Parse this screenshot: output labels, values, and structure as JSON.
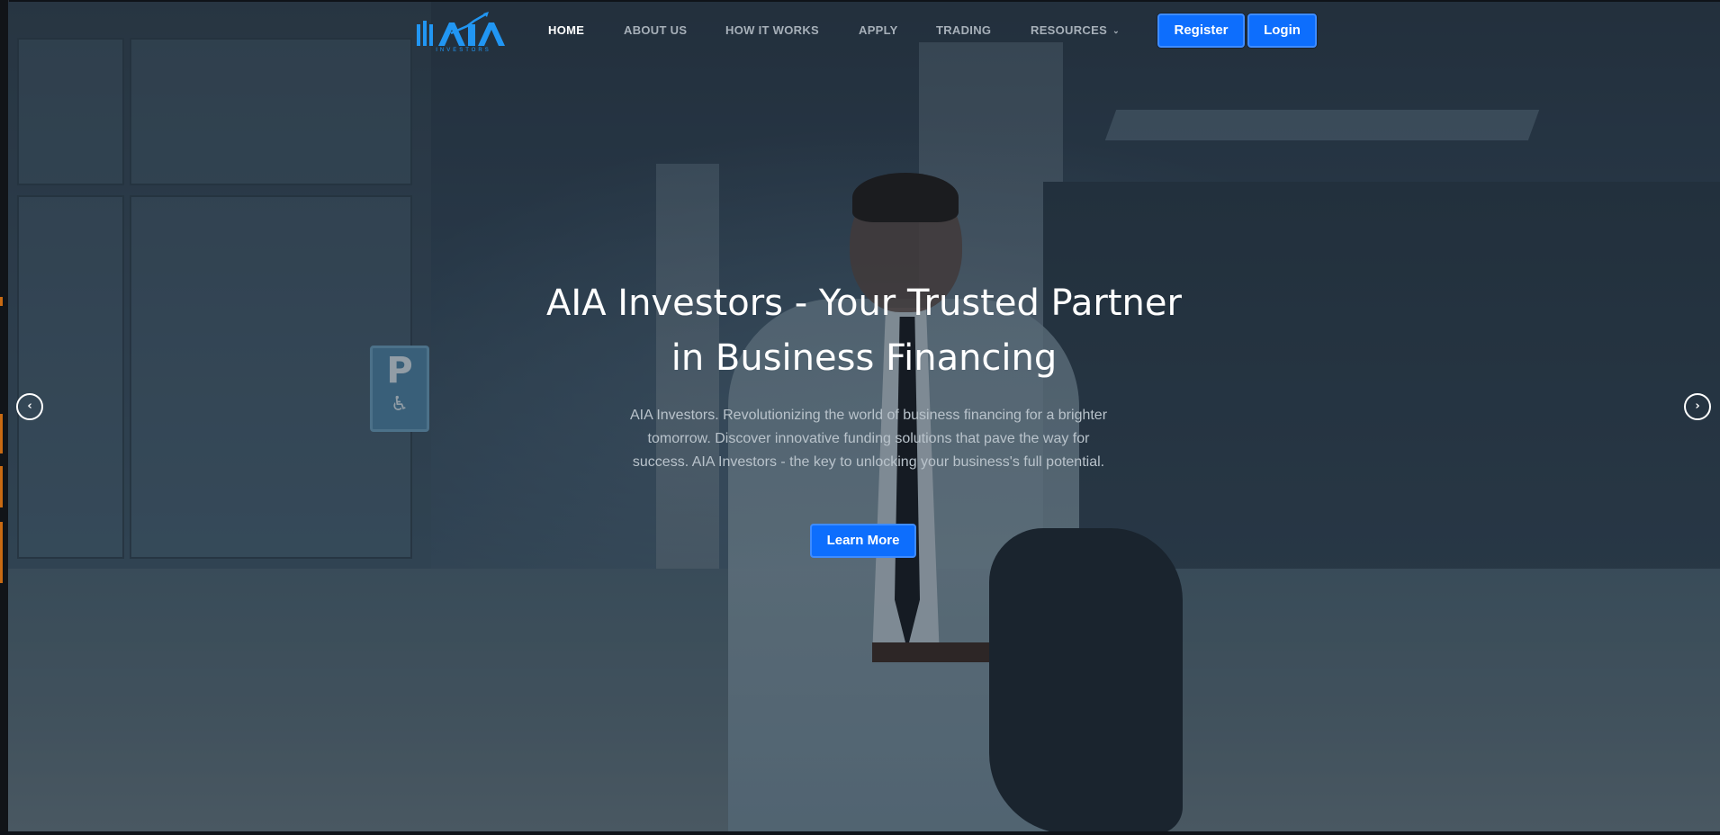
{
  "brand": {
    "name": "AIA",
    "tagline": "INVESTORS",
    "accent_color": "#0d6efd",
    "logo_color": "#2196f3"
  },
  "nav": {
    "items": [
      {
        "label": "HOME",
        "active": true
      },
      {
        "label": "ABOUT US",
        "active": false
      },
      {
        "label": "HOW IT WORKS",
        "active": false
      },
      {
        "label": "APPLY",
        "active": false
      },
      {
        "label": "TRADING",
        "active": false
      },
      {
        "label": "RESOURCES",
        "active": false,
        "dropdown": true
      }
    ],
    "register_label": "Register",
    "login_label": "Login"
  },
  "hero": {
    "title_line1": "AIA Investors - Your Trusted Partner",
    "title_line2": "in Business Financing",
    "description": "AIA Investors. Revolutionizing the world of business financing for a brighter tomorrow. Discover innovative funding solutions that pave the way for success. AIA Investors - the key to unlocking your business's full potential.",
    "cta_label": "Learn More",
    "prev_icon": "chevron-left-icon",
    "next_icon": "chevron-right-icon",
    "parking_sign": "P"
  }
}
